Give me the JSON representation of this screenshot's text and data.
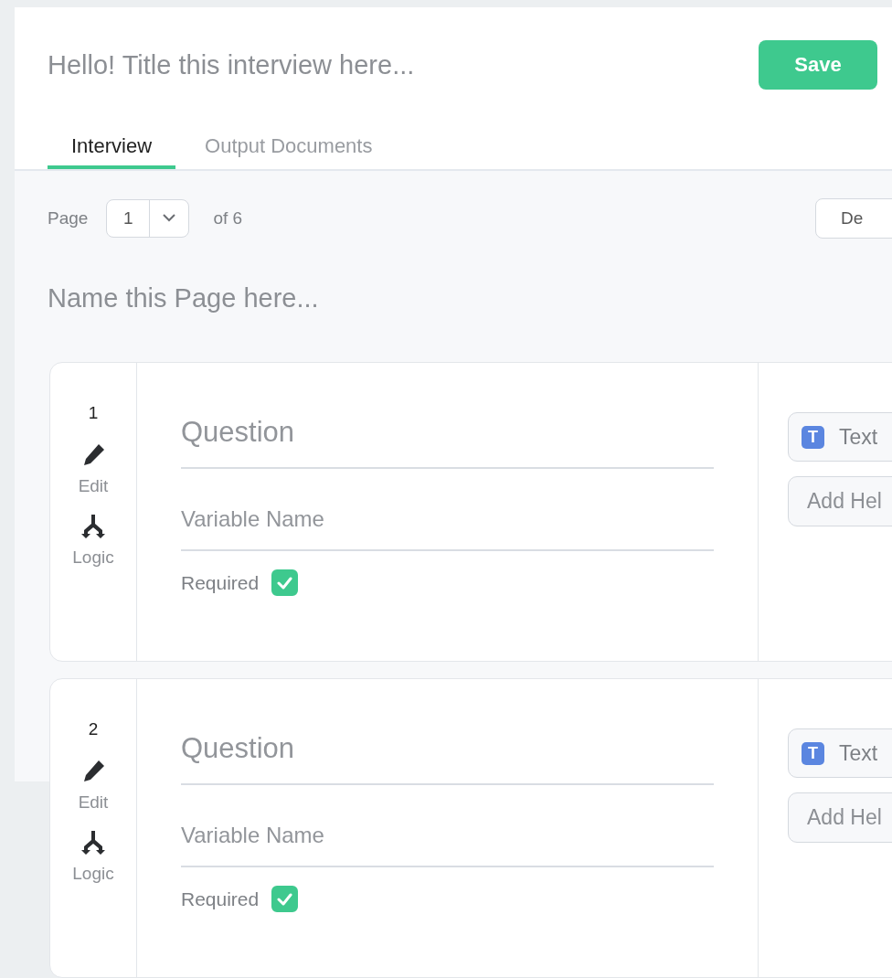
{
  "title_field": {
    "placeholder": "Hello! Title this interview here..."
  },
  "save_button": "Save",
  "tabs": [
    {
      "label": "Interview",
      "selected": true
    },
    {
      "label": "Output Documents",
      "selected": false
    }
  ],
  "pager": {
    "label": "Page",
    "value": "1",
    "of_text": "of 6"
  },
  "right_button": "De",
  "page_name_field": {
    "placeholder": "Name this Page here..."
  },
  "questions": [
    {
      "number": "1",
      "actions": [
        {
          "kind": "edit",
          "label": "Edit"
        },
        {
          "kind": "logic",
          "label": "Logic"
        }
      ],
      "question_placeholder": "Question",
      "variable_placeholder": "Variable Name",
      "required_label": "Required",
      "required": true,
      "type_badge": "T",
      "type_label": "Text",
      "help_placeholder": "Add Hel"
    },
    {
      "number": "2",
      "actions": [
        {
          "kind": "edit",
          "label": "Edit"
        },
        {
          "kind": "logic",
          "label": "Logic"
        }
      ],
      "question_placeholder": "Question",
      "variable_placeholder": "Variable Name",
      "required_label": "Required",
      "required": true,
      "type_badge": "T",
      "type_label": "Text",
      "help_placeholder": "Add Hel"
    }
  ]
}
